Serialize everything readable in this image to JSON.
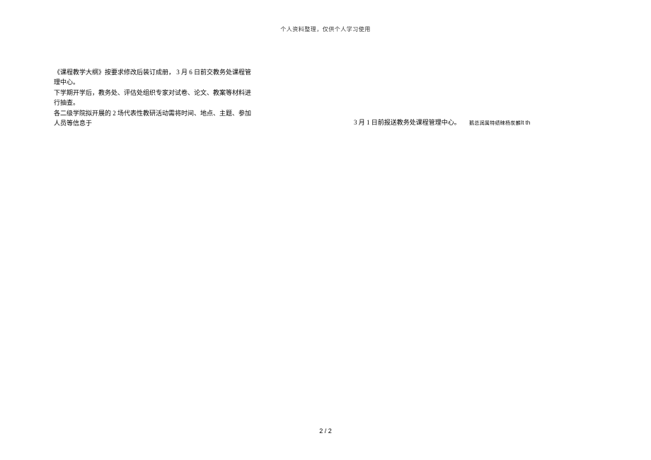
{
  "header": {
    "notice": "个人资料整理，仅供个人学习使用"
  },
  "body": {
    "para1_a": "《课程教学大纲》按要求修改后装订成册，",
    "para1_b": " 3 月 6 日前交教务处课程管理中心。",
    "para2": "下学期开学后，教务处、评估处组织专家对试卷、论文、教案等材料进行抽查。",
    "para3_a": "各二级学院拟开展的",
    "para3_b": " 2 场代表性教研活动需将时间、地点、主题、参加人员等信息于"
  },
  "right": {
    "main": "3 月  1 日前报送教务处课程管理中心。",
    "small": "鹅总润属特绩睐杨炭麟",
    "tail": "It th"
  },
  "footer": {
    "page": "2 / 2"
  }
}
